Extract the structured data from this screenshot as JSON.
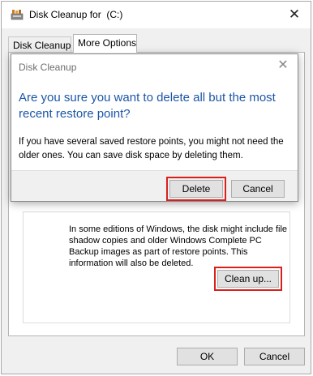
{
  "window": {
    "title": "Disk Cleanup for  (C:)",
    "close_glyph": "✕",
    "icon": "disk-cleanup-icon"
  },
  "tabs": [
    {
      "label": "Disk Cleanup",
      "active": false
    },
    {
      "label": "More Options",
      "active": true
    }
  ],
  "restore_section": {
    "description": "In some editions of Windows, the disk might include file shadow copies and older Windows Complete PC Backup images as part of restore points. This information will also be deleted.",
    "cleanup_label": "Clean up..."
  },
  "footer": {
    "ok_label": "OK",
    "cancel_label": "Cancel"
  },
  "dialog": {
    "title": "Disk Cleanup",
    "close_glyph": "✕",
    "heading": "Are you sure you want to delete all but the most recent restore point?",
    "body": "If you have several saved restore points, you might not need the older ones. You can save disk space by deleting them.",
    "delete_label": "Delete",
    "cancel_label": "Cancel"
  },
  "colors": {
    "heading_blue": "#1b56a6",
    "highlight_red": "#d9201c"
  }
}
